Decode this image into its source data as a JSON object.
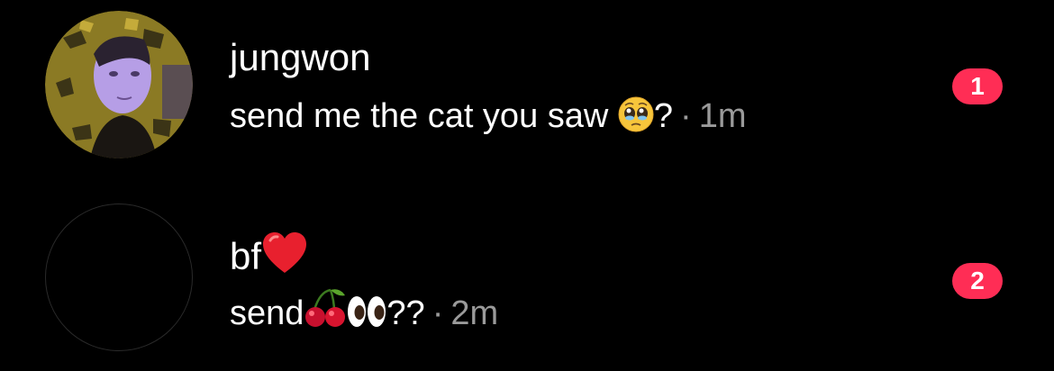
{
  "conversations": [
    {
      "name": "jungwon",
      "message": "send me the cat you saw",
      "message_suffix": "?",
      "separator": "·",
      "time": "1m",
      "unread": "1",
      "emoji": "pleading-face-icon"
    },
    {
      "name": "bf",
      "name_emoji": "red-heart-icon",
      "message": "send",
      "message_suffix": "??",
      "separator": "·",
      "time": "2m",
      "unread": "2",
      "emojis": [
        "cherries-icon",
        "eyes-icon"
      ]
    }
  ],
  "colors": {
    "background": "#000000",
    "text": "#ffffff",
    "muted": "#9a9a9a",
    "badge": "#ff2d55"
  }
}
